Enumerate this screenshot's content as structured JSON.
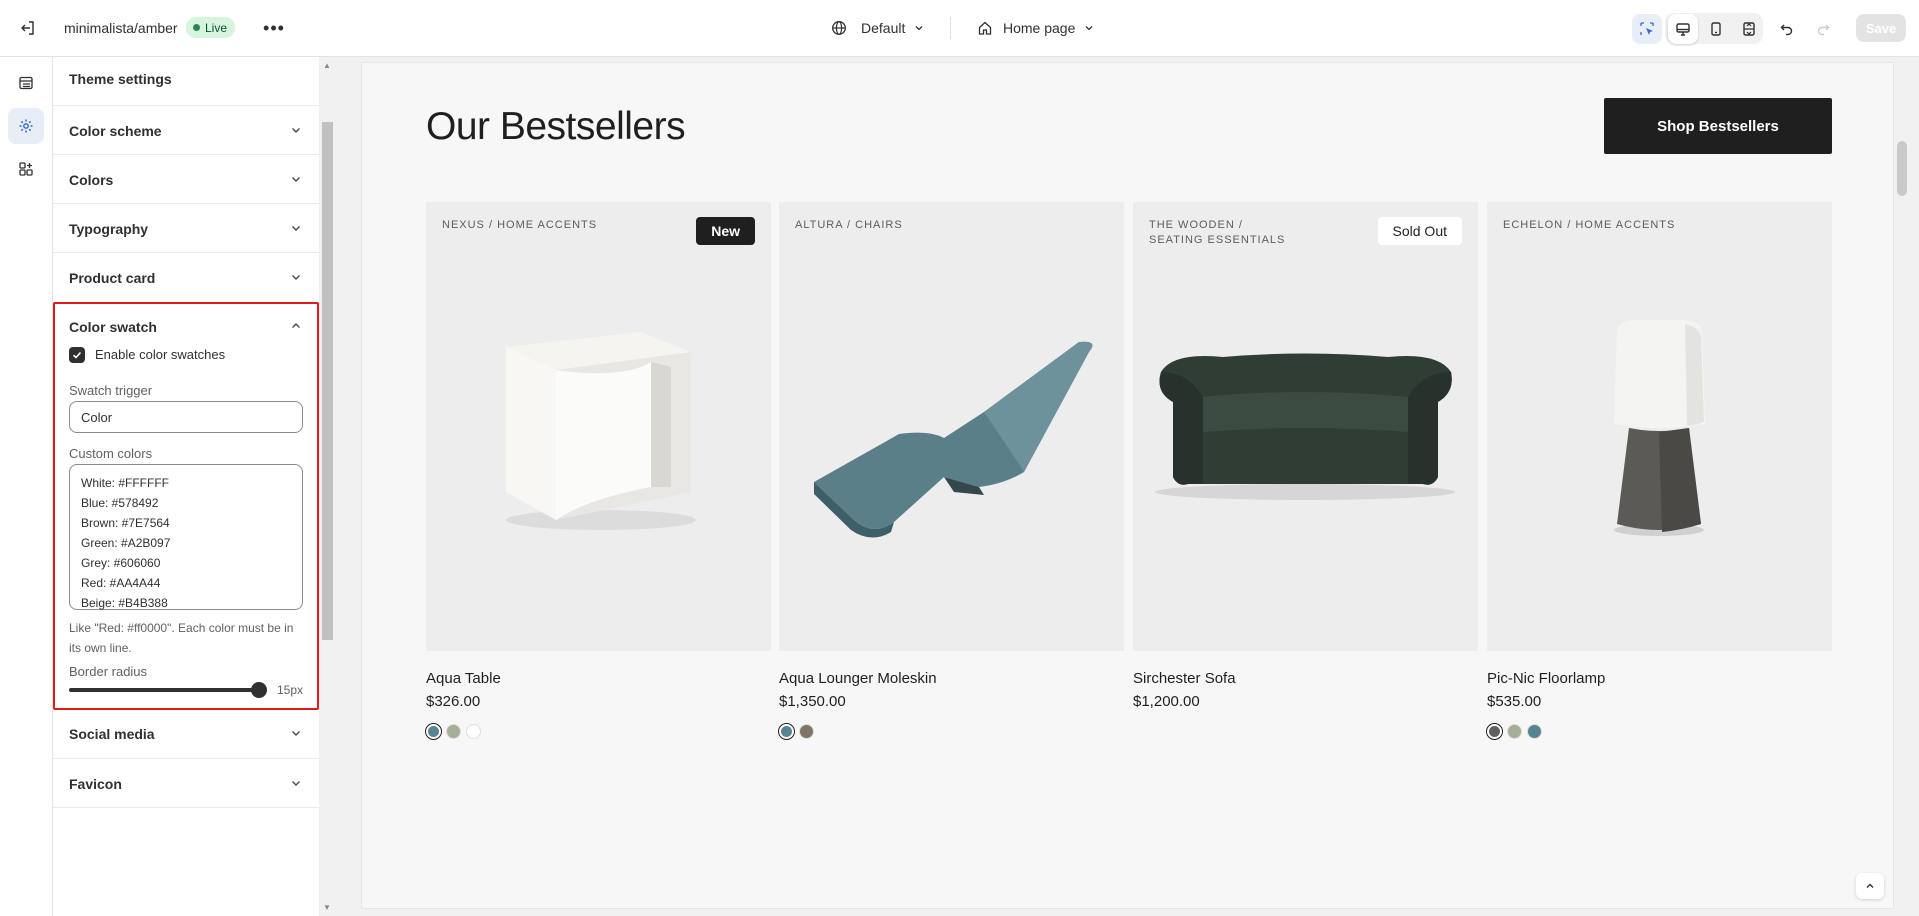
{
  "topbar": {
    "store_name": "minimalista/amber",
    "status": "Live",
    "more": "•••",
    "theme_selector": "Default",
    "page_selector": "Home page",
    "save_label": "Save"
  },
  "panel": {
    "title": "Theme settings",
    "sections": [
      {
        "label": "Color scheme"
      },
      {
        "label": "Colors"
      },
      {
        "label": "Typography"
      },
      {
        "label": "Product card"
      }
    ],
    "color_swatch": {
      "label": "Color swatch",
      "enable_label": "Enable color swatches",
      "trigger_label": "Swatch trigger",
      "trigger_value": "Color",
      "custom_colors_label": "Custom colors",
      "custom_colors_lines": [
        "White: #FFFFFF",
        "Blue: #578492",
        "Brown: #7E7564",
        "Green: #A2B097",
        "Grey: #606060",
        "Red: #AA4A44",
        "Beige: #B4B388"
      ],
      "help_text": "Like \"Red: #ff0000\". Each color must be in its own line.",
      "border_radius_label": "Border radius",
      "border_radius_value": "15px"
    },
    "sections_after": [
      {
        "label": "Social media"
      },
      {
        "label": "Favicon"
      }
    ]
  },
  "preview": {
    "heading": "Our Bestsellers",
    "shop_button": "Shop Bestsellers",
    "products": [
      {
        "crumb_line1": "NEXUS  /  HOME ACCENTS",
        "crumb_line2": "",
        "badge": "New",
        "title": "Aqua Table",
        "price": "$326.00",
        "swatches": [
          "#578492",
          "#A2B097",
          "#FFFFFF"
        ]
      },
      {
        "crumb_line1": "ALTURA  /  CHAIRS",
        "crumb_line2": "",
        "badge": "",
        "title": "Aqua Lounger Moleskin",
        "price": "$1,350.00",
        "swatches": [
          "#578492",
          "#7E7564"
        ]
      },
      {
        "crumb_line1": "THE WOODEN  /",
        "crumb_line2": "SEATING ESSENTIALS",
        "badge": "Sold Out",
        "title": "Sirchester Sofa",
        "price": "$1,200.00",
        "swatches": []
      },
      {
        "crumb_line1": "ECHELON  /  HOME ACCENTS",
        "crumb_line2": "",
        "badge": "",
        "title": "Pic-Nic Floorlamp",
        "price": "$535.00",
        "swatches": [
          "#606060",
          "#A2B097",
          "#578492"
        ]
      }
    ]
  }
}
